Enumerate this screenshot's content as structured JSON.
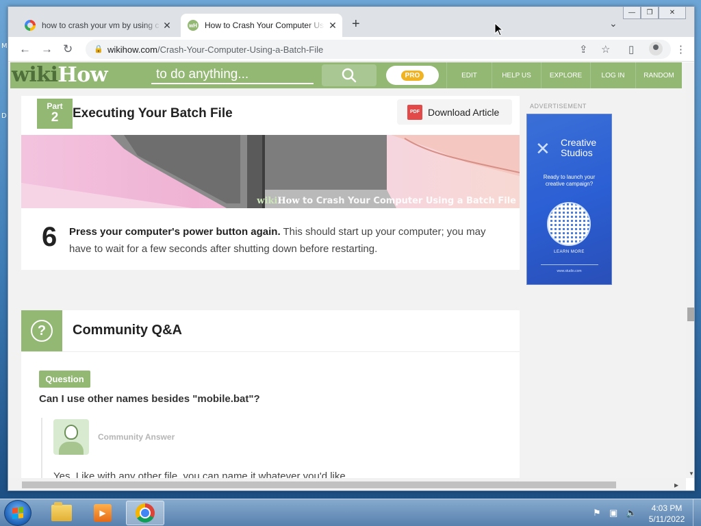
{
  "desktop": {
    "edge_texts": [
      "M",
      "D"
    ]
  },
  "browser": {
    "tabs": [
      {
        "title": "how to crash your vm by using c",
        "active": false,
        "close": "✕"
      },
      {
        "title": "How to Crash Your Computer Usi",
        "active": true,
        "close": "✕"
      }
    ],
    "new_tab": "+",
    "tab_search": "⌄",
    "window_buttons": {
      "minimize": "—",
      "maximize": "❐",
      "close": "✕"
    },
    "nav": {
      "back": "←",
      "forward": "→",
      "reload": "↻"
    },
    "url_host": "wikihow.com",
    "url_path": "/Crash-Your-Computer-Using-a-Batch-File"
  },
  "wikihow": {
    "logo_a": "wiki",
    "logo_b": "How",
    "search_placeholder": "to do anything...",
    "pro_label": "PRO",
    "nav": [
      "EDIT",
      "HELP US",
      "EXPLORE",
      "LOG IN",
      "RANDOM"
    ],
    "part_label": "Part",
    "part_number": "2",
    "part_title": "Executing Your Batch File",
    "download_label": "Download Article",
    "pdf_icon_label": "PDF",
    "image_caption_a": "wiki",
    "image_caption_b": "How",
    "image_caption_c": " to Crash Your Computer Using a Batch File",
    "step_number": "6",
    "step_bold": "Press your computer's power button again.",
    "step_text": " This should start up your computer; you may have to wait for a few seconds after shutting down before restarting.",
    "qa_title": "Community Q&A",
    "question_badge": "Question",
    "question": "Can I use other names besides \"mobile.bat\"?",
    "answer_label": "Community Answer",
    "answer": "Yes. Like with any other file, you can name it whatever you'd like."
  },
  "ad": {
    "label": "ADVERTISEMENT",
    "brand_line1": "Creative",
    "brand_line2": "Studios",
    "tagline": "Ready to launch your creative campaign?",
    "cta": "LEARN MORE",
    "url": "www.studio.com"
  },
  "taskbar": {
    "time": "4:03 PM",
    "date": "5/11/2022"
  },
  "colors": {
    "wikihow_green": "#93b874",
    "ad_blue": "#2b5fd4"
  }
}
